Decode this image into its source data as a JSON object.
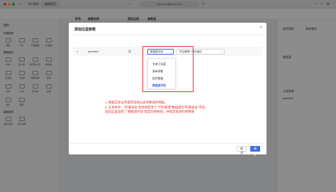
{
  "browser": {
    "tabs": [
      "学生管理",
      "编辑学生"
    ],
    "url": "cyzd.orangeforms.com",
    "colors": {
      "red": "#ff5f57",
      "yellow": "#febc2e",
      "green": "#28c840"
    }
  },
  "left_panel": {
    "title": "组件",
    "sections": [
      "布局组件",
      "基础组件",
      "高级组件"
    ],
    "layout_items": [
      "栅格",
      "卡片",
      "分组面板",
      "Tab面板"
    ],
    "basic_items": [
      "文本",
      "输入框",
      "数字输入框",
      "单选框",
      "多选框",
      "下拉框",
      "级联选择",
      "日期",
      "开关",
      "上传",
      "富文本",
      "表格",
      "图片",
      "按钮"
    ],
    "advanced_items": [
      "组织选择",
      "用户选择"
    ]
  },
  "right_panel": {
    "tabs": [
      "组件属性",
      "表单属性"
    ],
    "labels": [
      "数据源",
      "过滤参数",
      "parentId"
    ]
  },
  "modal": {
    "title": "添加过滤参数",
    "close_icon": "close-icon",
    "headers": [
      "序号",
      "参数名称",
      "是否必填",
      "参数值"
    ],
    "row": {
      "index": "1",
      "name": "parentId",
      "required": "否",
      "value_type": "数据源字段",
      "value_field": "学生管理 / 所在省份"
    },
    "dropdown_options": [
      "字典下拉表",
      "表单参数",
      "组件数据",
      "数据源字段"
    ],
    "dropdown_active_index": 3,
    "note_lines": [
      "1. 根据实际业务需求选择过滤参数值的种类。",
      "2. 在本例中，“所属省份”组件绑定到了“学生管理”数据源的“所属省份”字段。",
      "因此这里选择了“数据源字段”类型的参数值，并指定具体的参数值"
    ],
    "cancel_label": "取消",
    "ok_label": "确定"
  },
  "colors": {
    "primary": "#3c6ee8",
    "annotation": "#e8312f"
  }
}
